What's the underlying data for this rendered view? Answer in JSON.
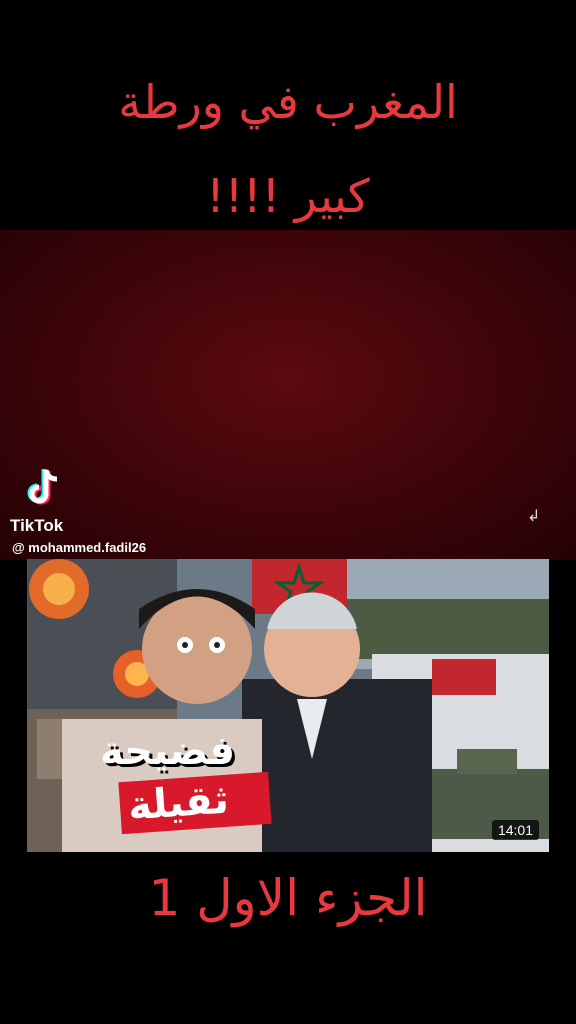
{
  "headline": {
    "line1": "المغرب في ورطة",
    "line2": "كبير !!!!"
  },
  "tiktok": {
    "brand": "TikTok",
    "username": "@ mohammed.fadil26"
  },
  "thumbnail": {
    "caption_top": "فضيحة",
    "caption_bottom": "ثقيلة",
    "duration": "14:01"
  },
  "footer": {
    "part_label": "الجزء الاول 1"
  },
  "colors": {
    "headline_red": "#e8393f",
    "panel_red": "#3d0509",
    "caption_red": "#d7192b"
  }
}
